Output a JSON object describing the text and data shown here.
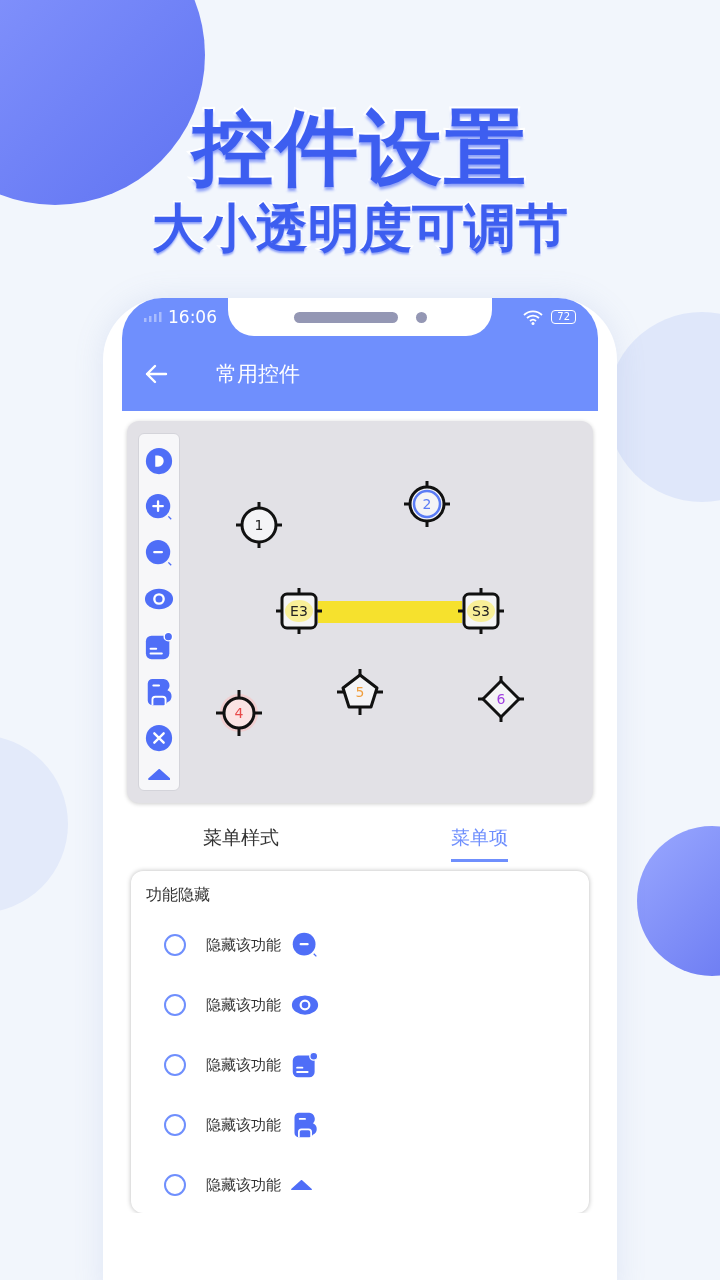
{
  "promo": {
    "title": "控件设置",
    "subtitle": "大小透明度可调节"
  },
  "status_bar": {
    "time": "16:06",
    "battery": "72"
  },
  "app_bar": {
    "title": "常用控件"
  },
  "map": {
    "markers": [
      {
        "label": "1",
        "kind": "circle",
        "color": "#222222"
      },
      {
        "label": "2",
        "kind": "ring",
        "color": "#5b7cf5"
      },
      {
        "label": "E3",
        "kind": "square",
        "color": "#222222"
      },
      {
        "label": "S3",
        "kind": "square",
        "color": "#222222"
      },
      {
        "label": "4",
        "kind": "glow",
        "color": "#e84a4a"
      },
      {
        "label": "5",
        "kind": "pentagon",
        "color": "#f0a040"
      },
      {
        "label": "6",
        "kind": "diamond",
        "color": "#a040e0"
      }
    ]
  },
  "tabs": [
    {
      "label": "菜单样式",
      "selected": false
    },
    {
      "label": "菜单项",
      "selected": true
    }
  ],
  "section": {
    "title": "功能隐藏",
    "options": [
      {
        "label": "隐藏该功能",
        "checked": false
      },
      {
        "label": "隐藏该功能",
        "checked": false
      },
      {
        "label": "隐藏该功能",
        "checked": false
      },
      {
        "label": "隐藏该功能",
        "checked": false
      },
      {
        "label": "隐藏该功能",
        "checked": false
      }
    ]
  }
}
